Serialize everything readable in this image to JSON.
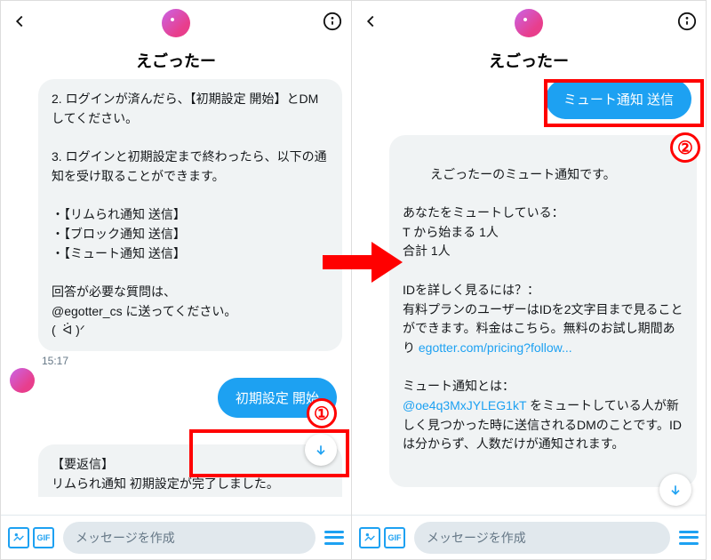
{
  "left": {
    "title": "えごったー",
    "bubble1": "2. ログインが済んだら、【初期設定 開始】とDMしてください。\n\n3. ログインと初期設定まで終わったら、以下の通知を受け取ることができます。\n\n・【リムられ通知 送信】\n・【ブロック通知 送信】\n・【ミュート通知 送信】\n\n回答が必要な質問は、\n@egotter_cs に送ってください。\n(  ᐛ )ᐟ",
    "handle": "@egotter_cs",
    "time1": "15:17",
    "pill": "初期設定 開始",
    "bubble2": "【要返信】\nリムられ通知 初期設定が完了しました。",
    "circle": "①"
  },
  "right": {
    "title": "えごったー",
    "pill": "ミュート通知 送信",
    "bubble1_top": "えごったーのミュート通知です。\n\nあなたをミュートしている：\nT から始まる 1人\n合計 1人\n\nIDを詳しく見るには？：\n有料プランのユーザーはIDを2文字目まで見ることができます。料金はこちら。無料のお試し期間あり ",
    "link1": "egotter.com/pricing?follow...",
    "bubble1_mid": "\n\nミュート通知とは：\n",
    "link2": "@oe4q3MxJYLEG1kT",
    "bubble1_bot": " をミュートしている人が新しく見つかった時に送信されるDMのことです。IDは分からず、人数だけが通知されます。",
    "circle": "②"
  },
  "composer_placeholder": "メッセージを作成",
  "gif_label": "GIF"
}
